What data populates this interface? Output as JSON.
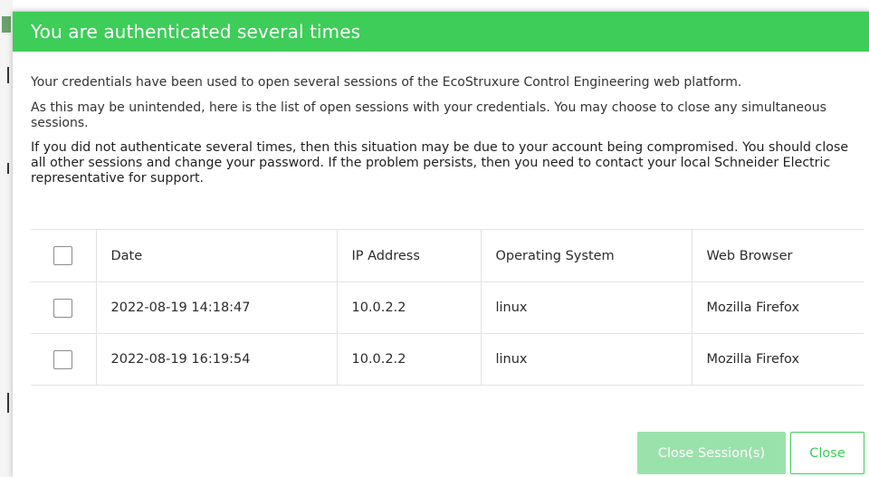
{
  "dialog": {
    "title": "You are authenticated several times",
    "paragraph1": "Your credentials have been used to open several sessions of the EcoStruxure Control Engineering web platform.",
    "paragraph2": "As this may be unintended, here is the list of open sessions with your credentials. You may choose to close any simultaneous sessions.",
    "paragraph3": "If you did not authenticate several times, then this situation may be due to your account being compromised. You should close all other sessions and change your password. If the problem persists, then you need to contact your local Schneider Electric representative for support."
  },
  "table": {
    "headers": {
      "date": "Date",
      "ip": "IP Address",
      "os": "Operating System",
      "browser": "Web Browser"
    },
    "rows": [
      {
        "date": "2022-08-19 14:18:47",
        "ip": "10.0.2.2",
        "os": "linux",
        "browser": "Mozilla Firefox",
        "checked": false
      },
      {
        "date": "2022-08-19 16:19:54",
        "ip": "10.0.2.2",
        "os": "linux",
        "browser": "Mozilla Firefox",
        "checked": false
      }
    ]
  },
  "buttons": {
    "close_sessions": "Close Session(s)",
    "close": "Close"
  },
  "colors": {
    "accent": "#3dcd58",
    "accent_disabled": "#9ae2ab"
  }
}
